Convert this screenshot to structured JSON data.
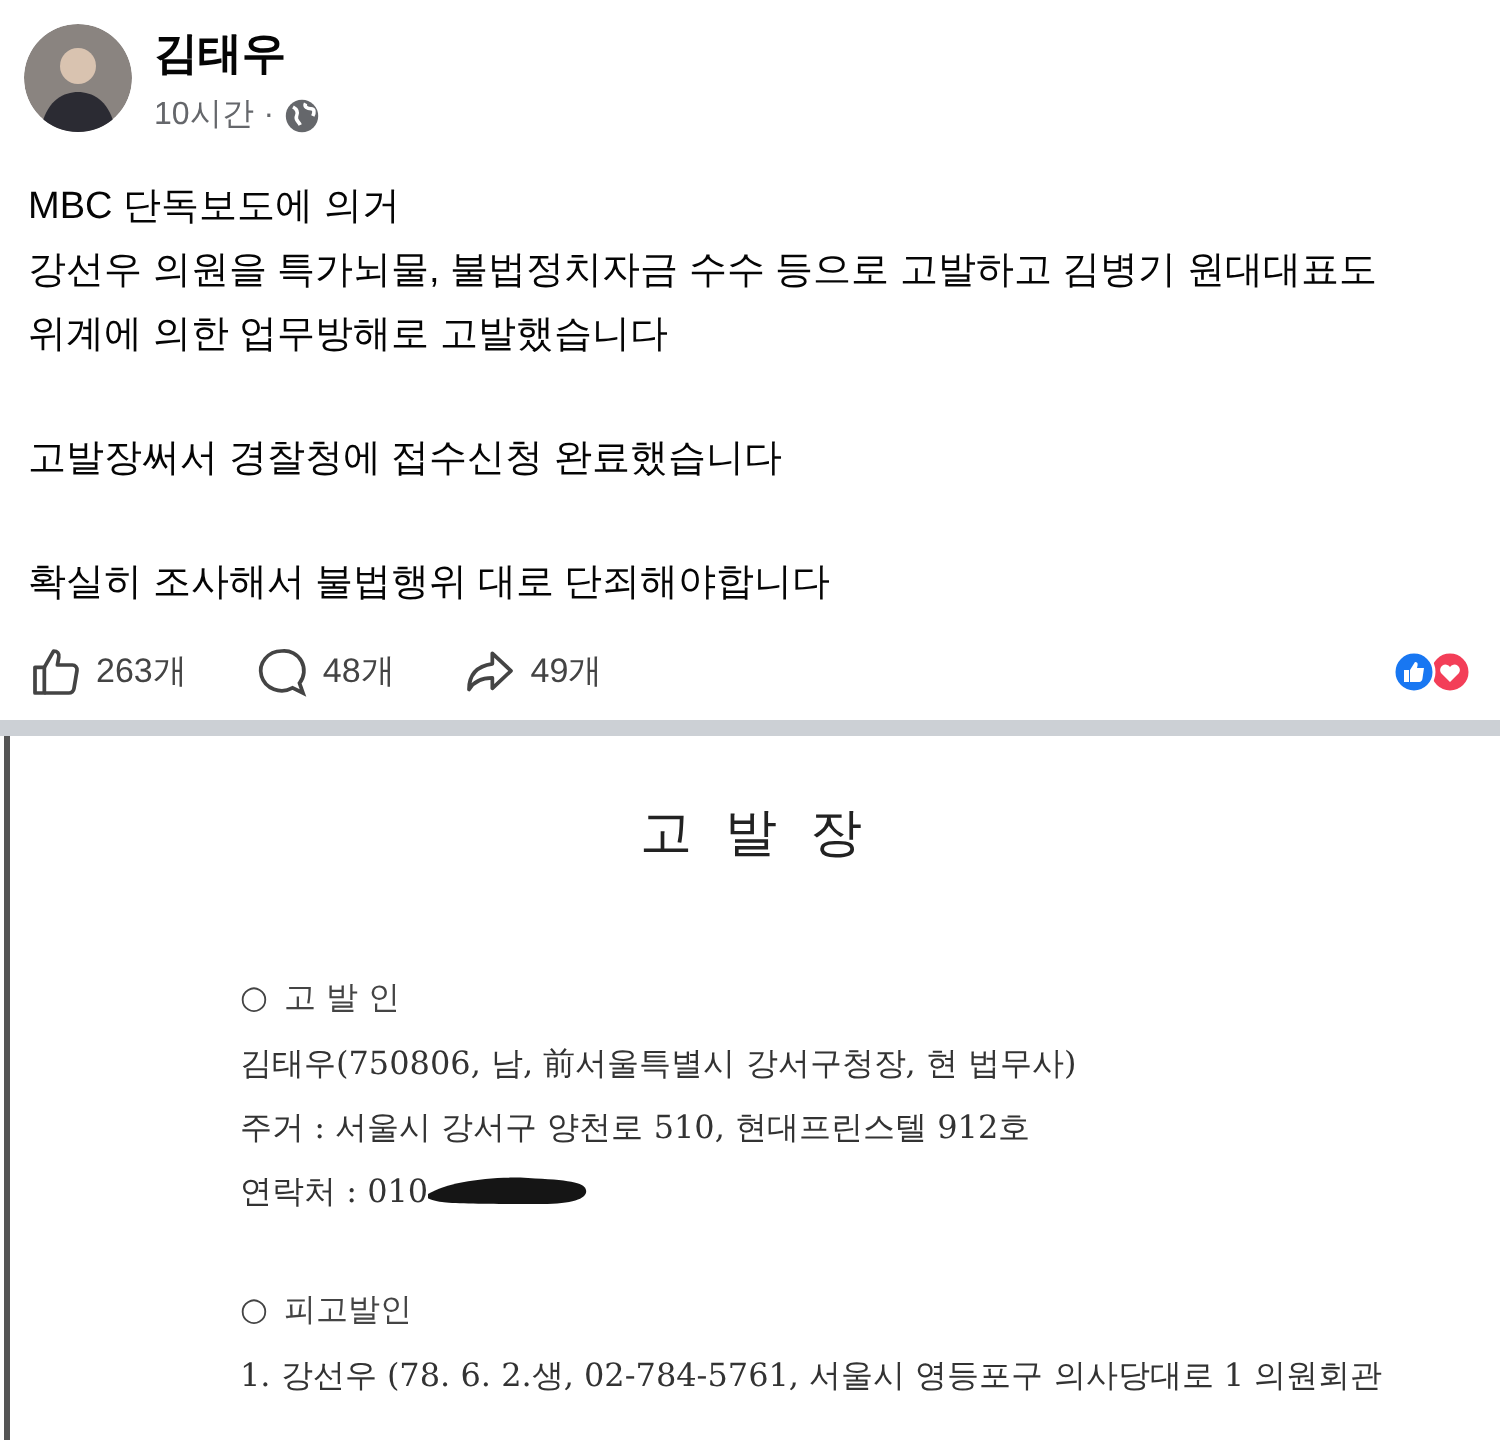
{
  "post": {
    "author": "김태우",
    "time": "10시간",
    "separator": "·",
    "paragraphs": [
      [
        "MBC 단독보도에 의거",
        "강선우 의원을 특가뇌물, 불법정치자금 수수 등으로 고발하고 김병기 원대대표도",
        "위계에 의한 업무방해로 고발했습니다"
      ],
      [
        "고발장써서 경찰청에 접수신청 완료했습니다"
      ],
      [
        "확실히 조사해서 불법행위 대로 단죄해야합니다"
      ]
    ],
    "actions": [
      {
        "kind": "like",
        "count": "263개"
      },
      {
        "kind": "comment",
        "count": "48개"
      },
      {
        "kind": "share",
        "count": "49개"
      }
    ]
  },
  "document": {
    "title": "고 발 장",
    "sections": [
      {
        "marker": "○",
        "heading": "고 발 인",
        "lines": [
          {
            "text": "김태우(750806, 남, 前서울특별시 강서구청장, 현 법무사)",
            "redacted": false
          },
          {
            "text": "주거 : 서울시 강서구 양천로 510, 현대프린스텔 912호",
            "redacted": false
          },
          {
            "text": "연락처 : 010",
            "redacted": true
          }
        ]
      },
      {
        "marker": "○",
        "heading": "피고발인",
        "lines": [
          {
            "text": "1. 강선우 (78. 6. 2.생, 02-784-5761, 서울시 영등포구 의사당대로 1 의원회관",
            "redacted": false
          }
        ]
      }
    ]
  }
}
